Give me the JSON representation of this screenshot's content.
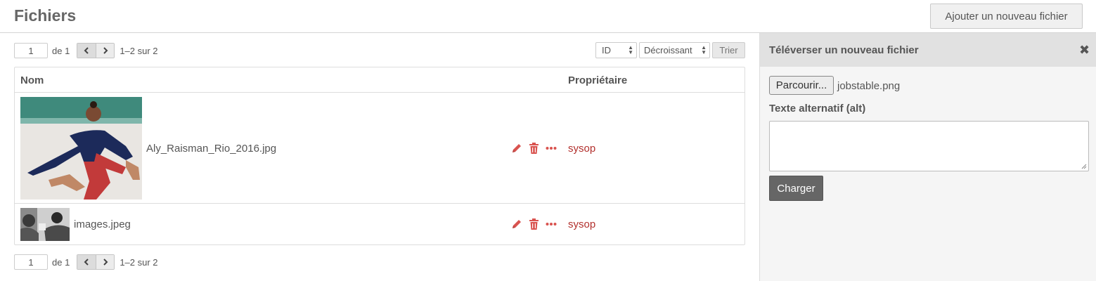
{
  "header": {
    "title": "Fichiers",
    "add_button": "Ajouter un nouveau fichier"
  },
  "pagination": {
    "page": "1",
    "of_label": "de 1",
    "range": "1–2 sur 2"
  },
  "sort": {
    "field": "ID",
    "order": "Décroissant",
    "button": "Trier"
  },
  "table": {
    "columns": {
      "name": "Nom",
      "owner": "Propriétaire"
    },
    "rows": [
      {
        "filename": "Aly_Raisman_Rio_2016.jpg",
        "owner": "sysop"
      },
      {
        "filename": "images.jpeg",
        "owner": "sysop"
      }
    ]
  },
  "upload_panel": {
    "title": "Téléverser un nouveau fichier",
    "browse_label": "Parcourir...",
    "chosen_file": "jobstable.png",
    "alt_label": "Texte alternatif (alt)",
    "alt_value": "",
    "submit_label": "Charger"
  },
  "colors": {
    "accent": "#b2302d",
    "action_icon": "#d9534f"
  }
}
